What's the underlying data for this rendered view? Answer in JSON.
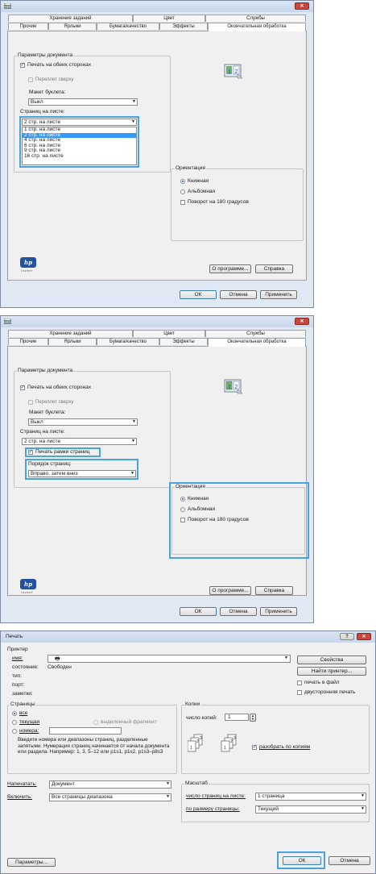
{
  "panel1": {
    "tabs_top": [
      "Хранение заданий",
      "Цвет",
      "Службы"
    ],
    "tabs_bottom": [
      "Прочие",
      "Ярлыки",
      "Бумага/качество",
      "Эффекты",
      "Окончательная обработка"
    ],
    "group_title": "Параметры документа",
    "duplex_label": "Печать на обеих сторонах",
    "flip_label": "Переплет сверху",
    "booklet_label": "Макет буклета:",
    "booklet_value": "Выкл",
    "pps_label": "Страниц на листе:",
    "pps_value": "2 стр. на листе",
    "pps_options": [
      "1 стр. на листе",
      "2 стр. на листе",
      "4 стр. на листе",
      "6 стр. на листе",
      "9 стр. на листе",
      "16 стр. на листе"
    ],
    "orientation_title": "Ориентация",
    "portrait": "Книжная",
    "landscape": "Альбомная",
    "rotate": "Поворот на 180 градусов",
    "about_btn": "О программе...",
    "help_btn": "Справка",
    "ok_btn": "ОК",
    "cancel_btn": "Отмена",
    "apply_btn": "Применить",
    "hp_logo": "hp",
    "hp_sub": "invent"
  },
  "panel2": {
    "tabs_top": [
      "Хранение заданий",
      "Цвет",
      "Службы"
    ],
    "tabs_bottom": [
      "Прочие",
      "Ярлыки",
      "Бумага/качество",
      "Эффекты",
      "Окончательная обработка"
    ],
    "group_title": "Параметры документа",
    "duplex_label": "Печать на обеих сторонах",
    "flip_label": "Переплет сверху",
    "booklet_label": "Макет буклета:",
    "booklet_value": "Выкл",
    "pps_label": "Страниц на листе:",
    "pps_value": "2 стр. на листе",
    "borders_label": "Печать рамки страниц",
    "order_label": "Порядок страниц:",
    "order_value": "Вправо, затем вниз",
    "orientation_title": "Ориентация",
    "portrait": "Книжная",
    "landscape": "Альбомная",
    "rotate": "Поворот на 180 градусов",
    "about_btn": "О программе...",
    "help_btn": "Справка",
    "ok_btn": "ОК",
    "cancel_btn": "Отмена",
    "apply_btn": "Применить",
    "hp_logo": "hp",
    "hp_sub": "invent"
  },
  "panel3": {
    "title": "Печать",
    "help_icon": "?",
    "printer_group": "Принтер",
    "name_label": "имя:",
    "status_label": "состояние:",
    "status_value": "Свободен",
    "type_label": "тип:",
    "port_label": "порт:",
    "notes_label": "заметки:",
    "properties_btn": "Свойства",
    "find_btn": "Найти принтер...",
    "print_to_file": "печать в файл",
    "duplex": "двусторонняя печать",
    "pages_group": "Страницы",
    "all": "все",
    "current": "текущая",
    "selection": "выделенный фрагмент",
    "numbers": "номера:",
    "hint": "Введите номера или диапазоны страниц, разделенные запятыми. Нумерация страниц начинается от начала документа или раздела. Например: 1, 3, 5–12 или p1s1, p1s2, p1s3–p8s3",
    "copies_group": "Копии",
    "copies_label": "число копий:",
    "copies_value": "1",
    "collate": "разобрать по копиям",
    "print_what_label": "Напечатать:",
    "print_what_value": "Документ",
    "include_label": "Включить:",
    "include_value": "Все страницы диапазона",
    "zoom_group": "Масштаб",
    "pps_label": "число страниц на листе:",
    "pps_value": "1 страница",
    "fit_label": "по размеру страницы:",
    "fit_value": "Текущий",
    "options_btn": "Параметры...",
    "ok_btn": "ОК",
    "cancel_btn": "Отмена"
  }
}
